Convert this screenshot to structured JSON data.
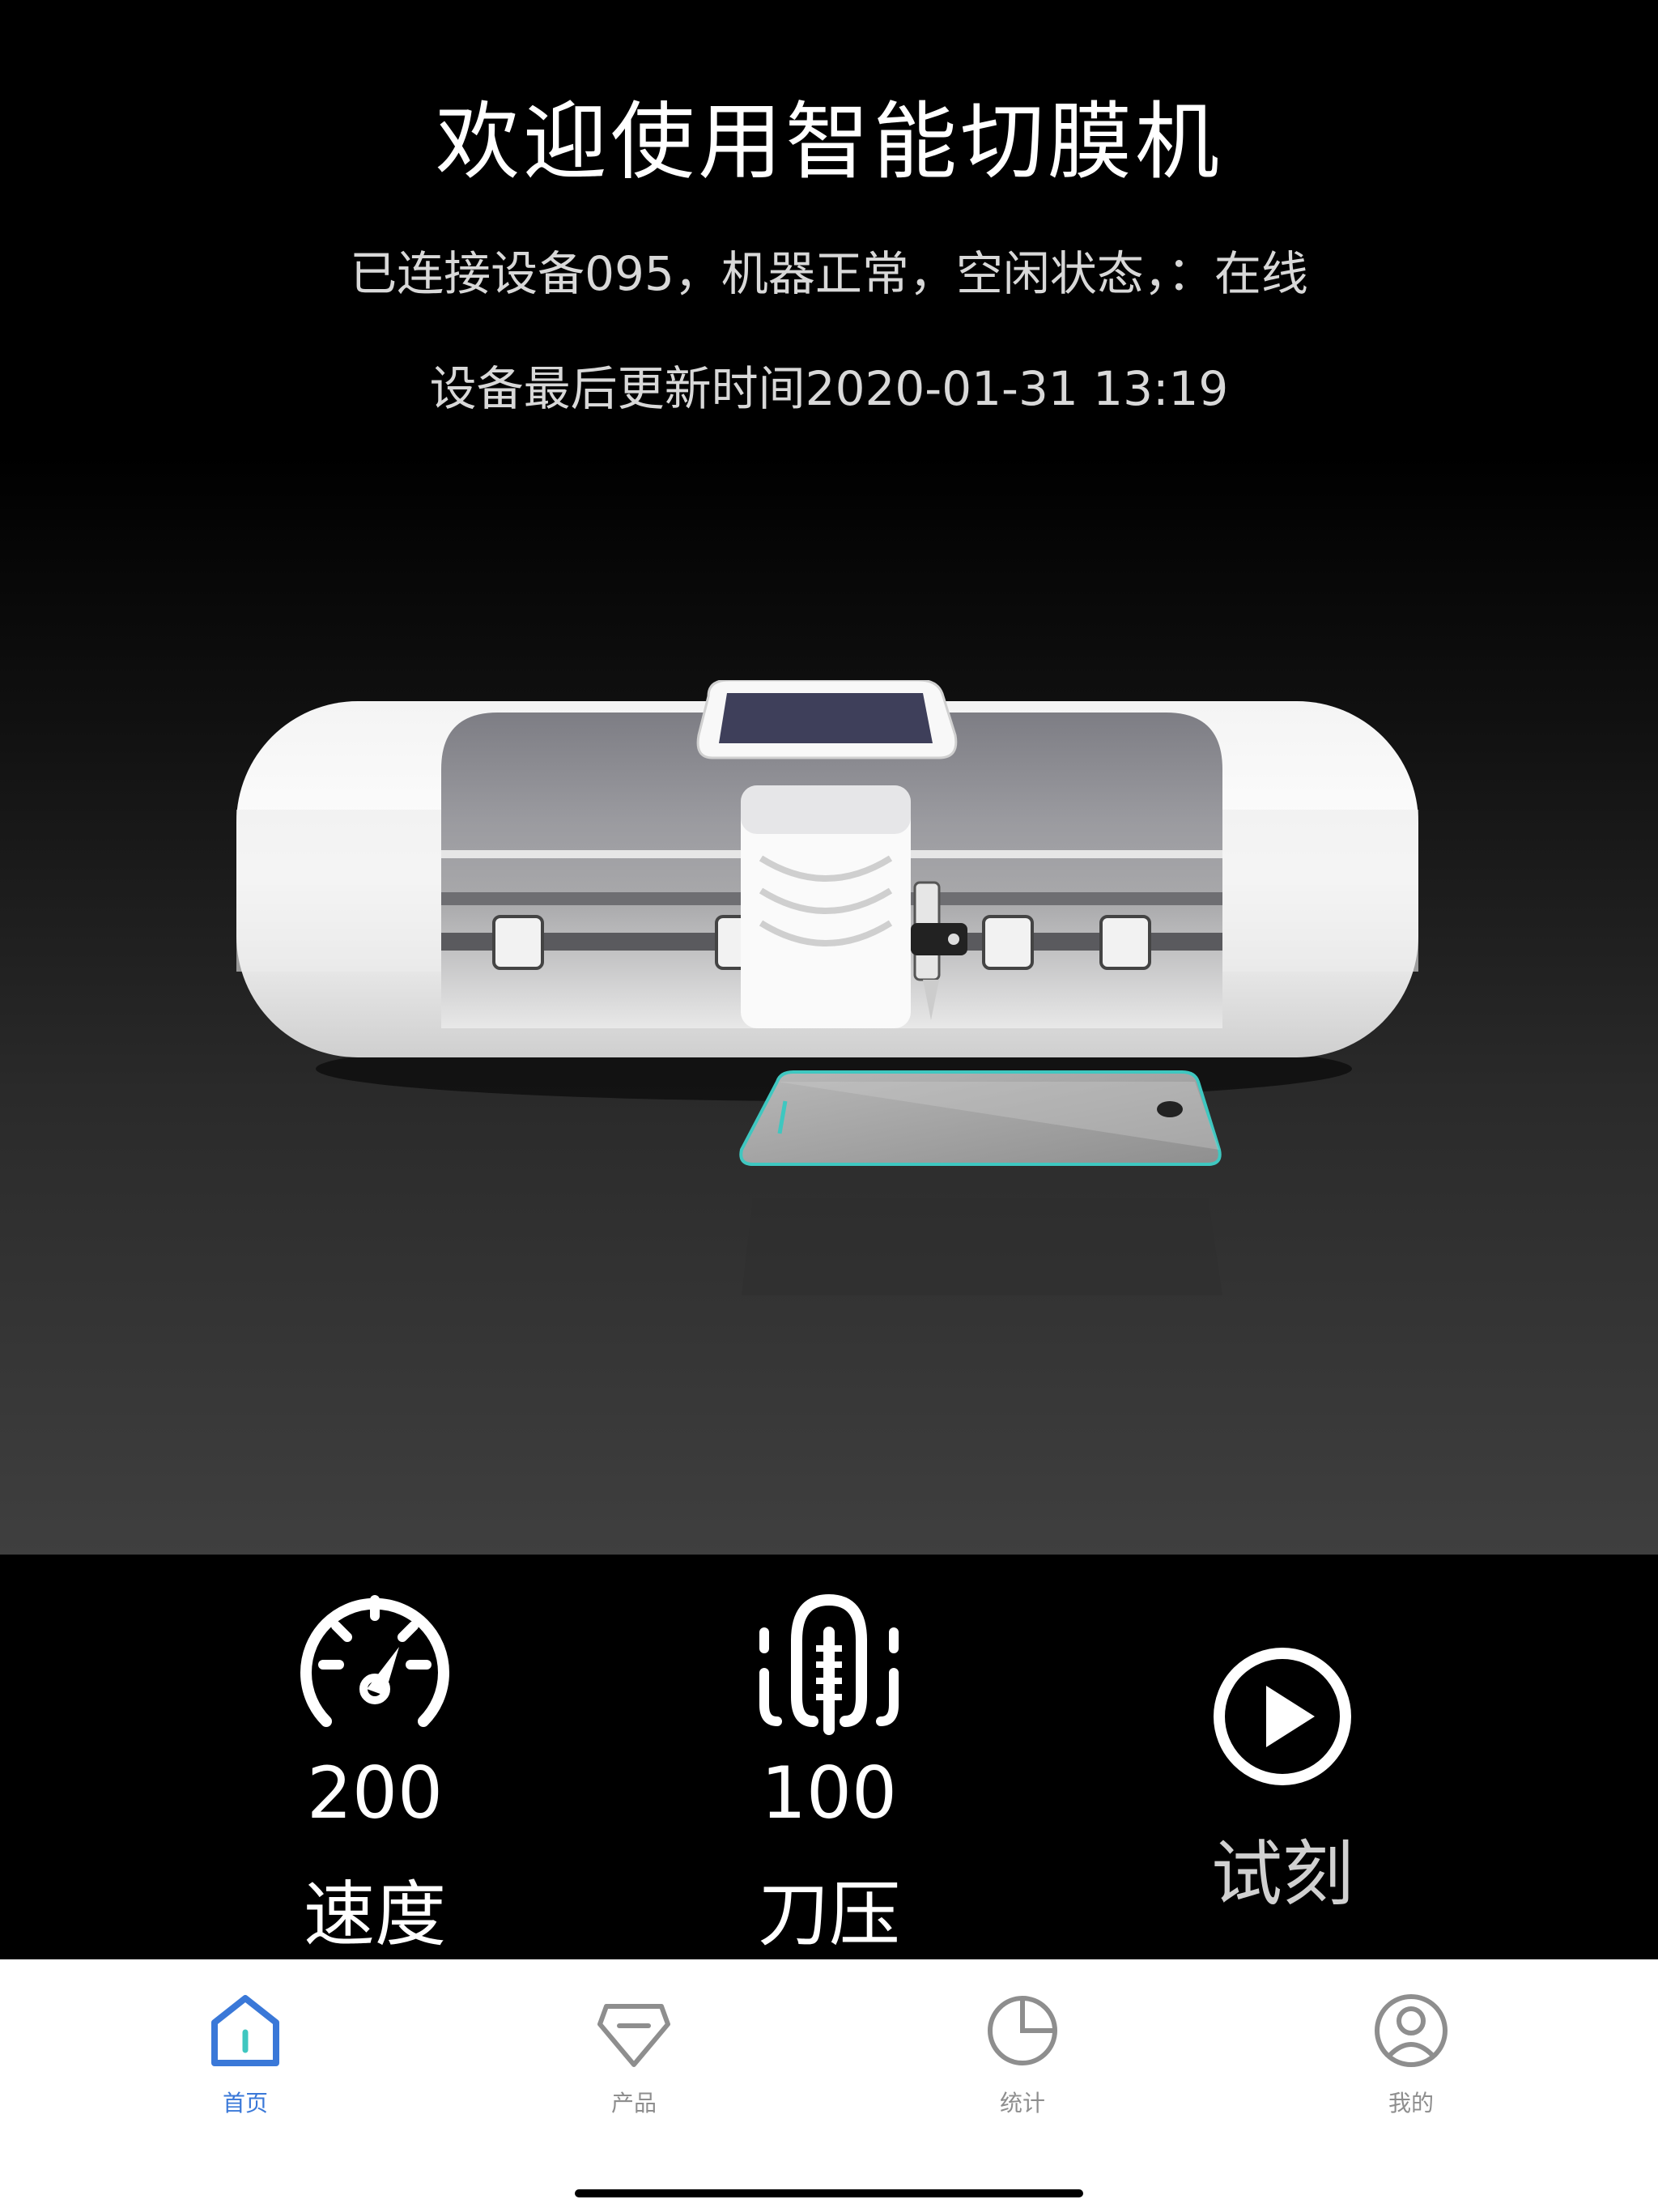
{
  "header": {
    "title": "欢迎使用智能切膜机",
    "status": "已连接设备095，机器正常，空闲状态，：在线",
    "last_update": "设备最后更新时间2020-01-31 13:19"
  },
  "controls": {
    "speed": {
      "value": "200",
      "label": "速度",
      "icon": "speedometer-icon"
    },
    "pressure": {
      "value": "100",
      "label": "刀压",
      "icon": "blade-pressure-icon"
    },
    "test": {
      "label": "试刻",
      "icon": "play-icon"
    }
  },
  "tabbar": {
    "items": [
      {
        "label": "首页",
        "icon": "home-icon",
        "active": true
      },
      {
        "label": "产品",
        "icon": "diamond-icon",
        "active": false
      },
      {
        "label": "统计",
        "icon": "pie-chart-icon",
        "active": false
      },
      {
        "label": "我的",
        "icon": "user-icon",
        "active": false
      }
    ]
  },
  "colors": {
    "background": "#000000",
    "accent": "#3a78d8",
    "inactive": "#8e8e8e",
    "signal": "#34c759",
    "film_edge": "#3fc7c0"
  }
}
